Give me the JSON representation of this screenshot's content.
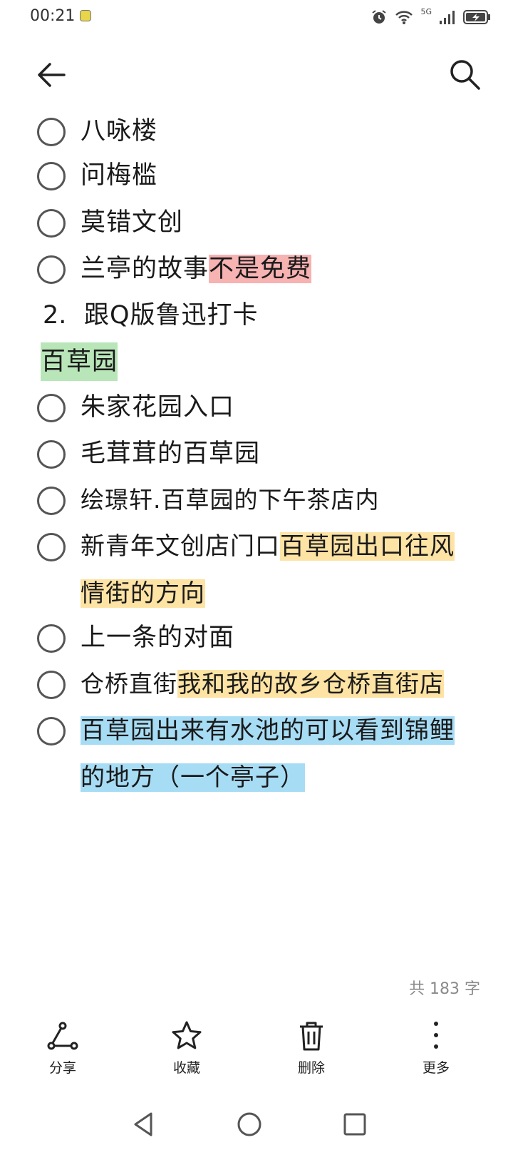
{
  "status_bar": {
    "time": "00:21",
    "network": "5G"
  },
  "header": {
    "back_icon": "arrow-left-icon",
    "search_icon": "search-icon"
  },
  "items": [
    {
      "type": "todo",
      "parts": [
        {
          "text": "八咏楼"
        }
      ]
    },
    {
      "type": "todo",
      "parts": [
        {
          "text": "问梅槛"
        }
      ]
    },
    {
      "type": "todo",
      "parts": [
        {
          "text": "莫错文创"
        }
      ]
    },
    {
      "type": "todo",
      "parts": [
        {
          "text": "兰亭的故事"
        },
        {
          "text": "不是免费",
          "highlight": "#f7b2b2"
        }
      ]
    },
    {
      "type": "numbered",
      "number": "2.",
      "text": "跟Q版鲁迅打卡"
    },
    {
      "type": "heading",
      "text": "百草园",
      "highlight": "#b9e6b9"
    },
    {
      "type": "todo",
      "parts": [
        {
          "text": "朱家花园入口"
        }
      ]
    },
    {
      "type": "todo",
      "parts": [
        {
          "text": "毛茸茸的百草园"
        }
      ]
    },
    {
      "type": "todo",
      "parts": [
        {
          "text": "绘璟轩.百草园的下午茶店内"
        }
      ]
    },
    {
      "type": "todo",
      "parts": [
        {
          "text": "新青年文创店门口"
        },
        {
          "text": "百草园出口往风情街的方向",
          "highlight": "#fde3a4"
        }
      ]
    },
    {
      "type": "todo",
      "parts": [
        {
          "text": "上一条的对面"
        }
      ]
    },
    {
      "type": "todo",
      "parts": [
        {
          "text": "仓桥直街"
        },
        {
          "text": "我和我的故乡仓桥直街店",
          "highlight": "#fde3a4"
        }
      ]
    },
    {
      "type": "todo",
      "parts": [
        {
          "text": "百草园出来有水池的可以看到锦鲤的地方（一个亭子）",
          "highlight": "#a7dcf5"
        }
      ]
    }
  ],
  "word_count": "共 183 字",
  "toolbar": [
    {
      "label": "分享",
      "icon": "share-icon"
    },
    {
      "label": "收藏",
      "icon": "star-icon"
    },
    {
      "label": "删除",
      "icon": "trash-icon"
    },
    {
      "label": "更多",
      "icon": "more-vertical-icon"
    }
  ],
  "nav": [
    "back-triangle-icon",
    "home-circle-icon",
    "recents-square-icon"
  ]
}
